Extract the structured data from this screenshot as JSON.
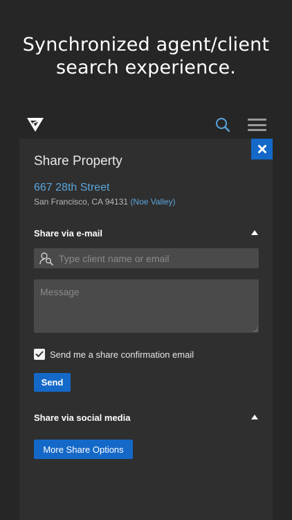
{
  "headline": {
    "line1": "Synchronized agent/client",
    "line2": "search experience."
  },
  "app": {
    "logo_icon": "brand-shield-logo-icon",
    "search_icon": "search-icon",
    "menu_icon": "hamburger-menu-icon",
    "close_icon": "close-icon"
  },
  "panel": {
    "title": "Share Property",
    "address": {
      "street": "667 28th Street",
      "city": "San Francisco, CA 94131",
      "neighborhood": "(Noe Valley)"
    }
  },
  "share_email": {
    "title": "Share via e-mail",
    "client_placeholder": "Type client name or email",
    "message_placeholder": "Message",
    "confirm_label": "Send me a share confirmation email",
    "confirm_checked": true,
    "send_label": "Send"
  },
  "share_social": {
    "title": "Share via social media",
    "more_label": "More Share Options"
  },
  "colors": {
    "accent": "#1469c8",
    "link": "#5aa5dc",
    "background": "#262626",
    "panel": "#2f2f2f",
    "input": "#4a4a4a"
  }
}
